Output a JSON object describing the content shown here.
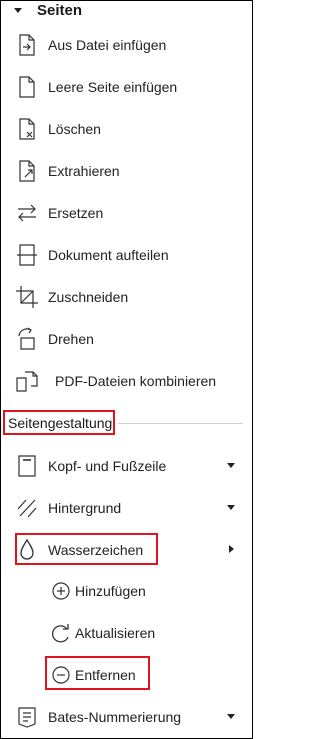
{
  "section": {
    "title": "Seiten"
  },
  "pages_items": [
    {
      "label": "Aus Datei einfügen",
      "icon": "insert-from-file-icon"
    },
    {
      "label": "Leere Seite einfügen",
      "icon": "blank-page-icon"
    },
    {
      "label": "Löschen",
      "icon": "delete-page-icon"
    },
    {
      "label": "Extrahieren",
      "icon": "extract-page-icon"
    },
    {
      "label": "Ersetzen",
      "icon": "replace-icon"
    },
    {
      "label": "Dokument aufteilen",
      "icon": "split-document-icon"
    },
    {
      "label": "Zuschneiden",
      "icon": "crop-icon"
    },
    {
      "label": "Drehen",
      "icon": "rotate-icon"
    },
    {
      "label": "PDF-Dateien kombinieren",
      "icon": "combine-files-icon"
    }
  ],
  "layout_group": {
    "title": "Seitengestaltung"
  },
  "layout_items": [
    {
      "label": "Kopf- und Fußzeile",
      "icon": "header-footer-icon"
    },
    {
      "label": "Hintergrund",
      "icon": "background-icon"
    },
    {
      "label": "Wasserzeichen",
      "icon": "watermark-drop-icon"
    }
  ],
  "watermark_sub": [
    {
      "label": "Hinzufügen",
      "icon": "add-circle-icon"
    },
    {
      "label": "Aktualisieren",
      "icon": "refresh-icon"
    },
    {
      "label": "Entfernen",
      "icon": "remove-circle-icon"
    }
  ],
  "bates": {
    "label": "Bates-Nummerierung",
    "icon": "bates-numbering-icon"
  },
  "colors": {
    "highlight": "#e0141e"
  }
}
